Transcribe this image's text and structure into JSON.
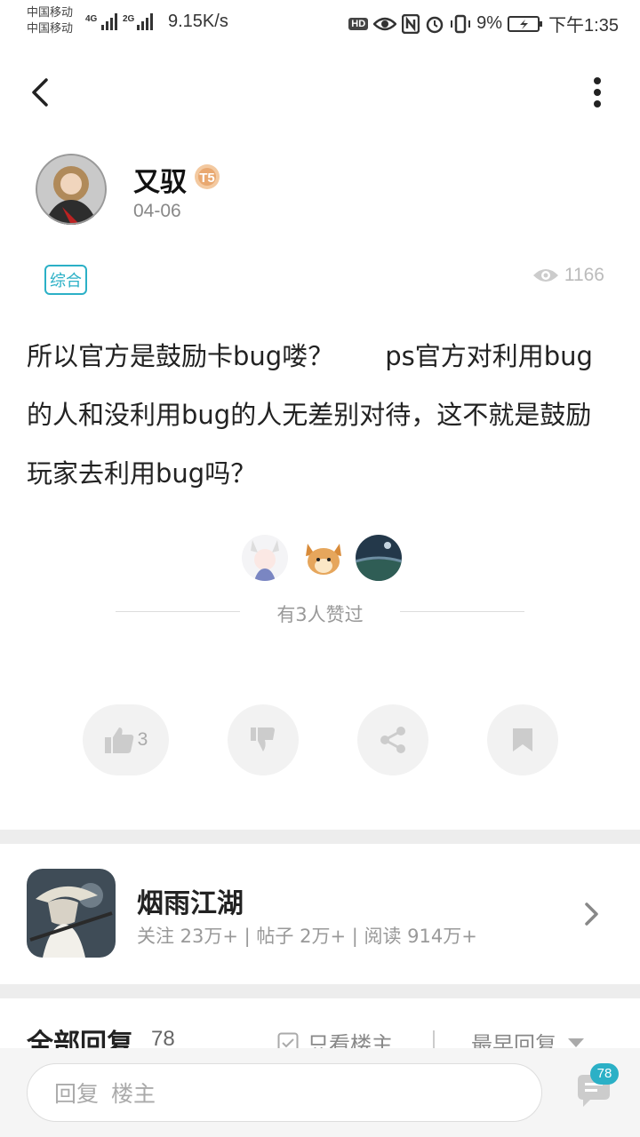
{
  "status_bar": {
    "carrier1": "中国移动",
    "carrier2": "中国移动",
    "net1": "4G",
    "net2": "2G",
    "speed": "9.15K/s",
    "hd": "HD",
    "battery": "9%",
    "time": "下午1:35"
  },
  "author": {
    "name": "又驭",
    "level": "T5",
    "date": "04-06"
  },
  "post": {
    "tag": "综合",
    "views": "1166",
    "content": "所以官方是鼓励卡bug喽？　　ps官方对利用bug的人和没利用bug的人无差别对待，这不就是鼓励玩家去利用bug吗？"
  },
  "likes": {
    "text": "有3人赞过"
  },
  "actions": {
    "like_count": "3"
  },
  "forum": {
    "name": "烟雨江湖",
    "stats": "关注 23万+  |  帖子 2万+  |  阅读 914万+"
  },
  "replies": {
    "title": "全部回复",
    "count": "78",
    "only_op": "只看楼主",
    "sort": "最早回复"
  },
  "bottom": {
    "placeholder1": "回复",
    "placeholder2": "楼主",
    "badge": "78"
  },
  "colors": {
    "accent": "#2bb0c6",
    "divider": "#ededed"
  }
}
